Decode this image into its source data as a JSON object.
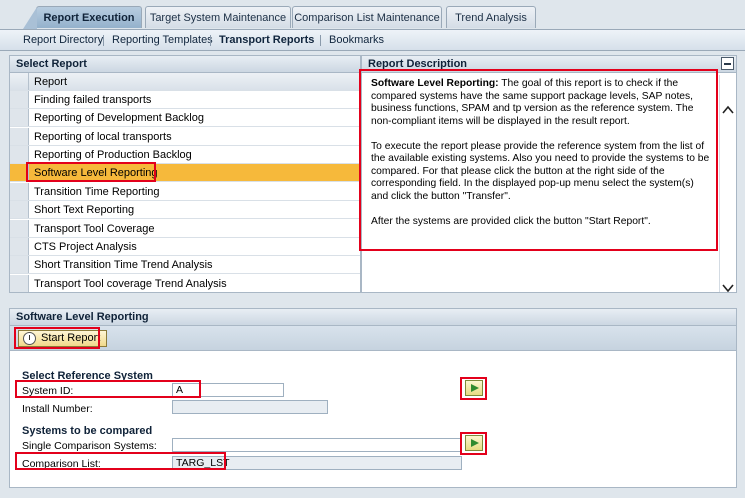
{
  "tabs": [
    {
      "label": "Report Execution",
      "active": true
    },
    {
      "label": "Target System Maintenance",
      "active": false
    },
    {
      "label": "Comparison List Maintenance",
      "active": false
    },
    {
      "label": "Trend Analysis",
      "active": false
    }
  ],
  "subnav": [
    {
      "label": "Report Directory",
      "active": false
    },
    {
      "label": "Reporting Templates",
      "active": false
    },
    {
      "label": "Transport Reports",
      "active": true
    },
    {
      "label": "Bookmarks",
      "active": false
    }
  ],
  "select_report": {
    "title": "Select Report",
    "column_header": "Report",
    "items": [
      "Finding failed transports",
      "Reporting of Development Backlog",
      "Reporting of local transports",
      "Reporting of Production Backlog",
      "Software Level Reporting",
      "Transition Time Reporting",
      "Short Text Reporting",
      "Transport Tool Coverage",
      "CTS Project Analysis",
      "Short Transition Time Trend Analysis",
      "Transport Tool coverage Trend Analysis"
    ],
    "selected_index": 4
  },
  "description": {
    "title": "Report Description",
    "heading": "Software Level Reporting:",
    "p1": " The goal of this report is to check if the compared systems have the same support package levels, SAP notes, business functions, SPAM and tp version as the reference system. The non-compliant items will be displayed in the result report.",
    "p2": "To execute the report please provide the reference system from the list of the available existing systems. Also you need to provide the systems to be compared. For that please click the button at the right side of the corresponding field. In the displayed pop-up menu select the system(s) and click the button \"Transfer\".",
    "p3": "After the systems are provided click the button \"Start Report\"."
  },
  "report_form": {
    "title": "Software Level Reporting",
    "start_button": "Start Report",
    "reference_title": "Select Reference System",
    "system_id_label": "System ID:",
    "system_id_value": "A",
    "install_number_label": "Install Number:",
    "install_number_value": "",
    "compared_title": "Systems to be compared",
    "single_label": "Single Comparison Systems:",
    "single_value": "",
    "comparison_list_label": "Comparison List:",
    "comparison_list_value": "TARG_LST"
  },
  "colors": {
    "highlight": "#e3001b",
    "selected_row": "#f6b93b"
  }
}
